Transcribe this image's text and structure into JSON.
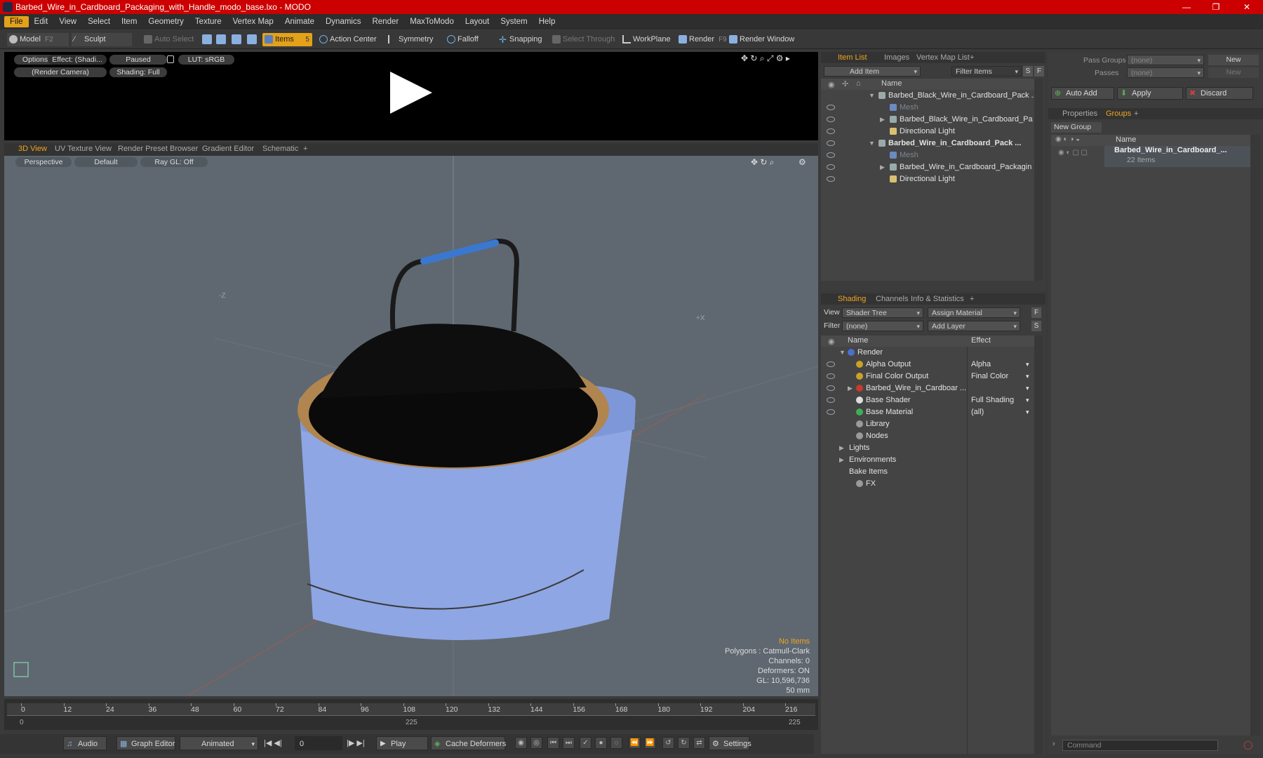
{
  "window": {
    "title": "Barbed_Wire_in_Cardboard_Packaging_with_Handle_modo_base.lxo - MODO",
    "controls": {
      "minimize": "—",
      "maximize": "❐",
      "close": "✕"
    }
  },
  "menu": [
    "File",
    "Edit",
    "View",
    "Select",
    "Item",
    "Geometry",
    "Texture",
    "Vertex Map",
    "Animate",
    "Dynamics",
    "Render",
    "MaxToModo",
    "Layout",
    "System",
    "Help"
  ],
  "toolbar": {
    "model": "Model",
    "model_key": "F2",
    "sculpt": "Sculpt",
    "auto_select": "Auto Select",
    "items": "Items",
    "items_key": "5",
    "action_center": "Action Center",
    "symmetry": "Symmetry",
    "falloff": "Falloff",
    "snapping": "Snapping",
    "select_through": "Select Through",
    "workplane": "WorkPlane",
    "render": "Render",
    "render_key": "F9",
    "render_window": "Render Window"
  },
  "preview": {
    "options": "Options",
    "effect": "Effect: (Shadi...",
    "paused": "Paused",
    "lut": "LUT: sRGB",
    "camera": "(Render Camera)",
    "shading": "Shading: Full"
  },
  "viewport_tabs": [
    "3D View",
    "UV Texture View",
    "Render Preset Browser",
    "Gradient Editor",
    "Schematic",
    "+"
  ],
  "viewport": {
    "perspective": "Perspective",
    "default": "Default",
    "raygl": "Ray GL: Off",
    "axis_neg_z": "-Z",
    "axis_pos_x": "+X",
    "stats": {
      "no_items": "No Items",
      "polygons": "Polygons : Catmull-Clark",
      "channels": "Channels: 0",
      "deformers": "Deformers: ON",
      "gl": "GL: 10,596,736",
      "lens": "50 mm"
    }
  },
  "timeline": {
    "ticks": [
      "0",
      "12",
      "24",
      "36",
      "48",
      "60",
      "72",
      "84",
      "96",
      "108",
      "120",
      "132",
      "144",
      "156",
      "168",
      "180",
      "192",
      "204",
      "216"
    ],
    "start": "0",
    "mid": "225",
    "end": "225"
  },
  "bottombar": {
    "audio": "Audio",
    "graph_editor": "Graph Editor",
    "animated": "Animated",
    "frame": "0",
    "play": "Play",
    "cache": "Cache Deformers",
    "settings": "Settings"
  },
  "itemlist": {
    "tabs": [
      "Item List",
      "Images",
      "Vertex Map List",
      "+"
    ],
    "add_item": "Add Item",
    "filter": "Filter Items",
    "s": "S",
    "f": "F",
    "col_name": "Name",
    "rows": [
      {
        "label": "Barbed_Black_Wire_in_Cardboard_Pack ...",
        "indent": 0,
        "bold": false,
        "eye": false,
        "tri": "▼"
      },
      {
        "label": "Mesh",
        "indent": 1,
        "bold": false,
        "dim": true,
        "eye": true,
        "tri": ""
      },
      {
        "label": "Barbed_Black_Wire_in_Cardboard_Pa ...",
        "indent": 1,
        "bold": false,
        "eye": true,
        "tri": "▶"
      },
      {
        "label": "Directional Light",
        "indent": 1,
        "bold": false,
        "eye": true,
        "tri": ""
      },
      {
        "label": "Barbed_Wire_in_Cardboard_Pack ...",
        "indent": 0,
        "bold": true,
        "eye": true,
        "tri": "▼"
      },
      {
        "label": "Mesh",
        "indent": 1,
        "bold": false,
        "dim": true,
        "eye": true,
        "tri": ""
      },
      {
        "label": "Barbed_Wire_in_Cardboard_Packagin ...",
        "indent": 1,
        "bold": false,
        "eye": true,
        "tri": "▶"
      },
      {
        "label": "Directional Light",
        "indent": 1,
        "bold": false,
        "eye": true,
        "tri": ""
      }
    ]
  },
  "shading": {
    "tabs": [
      "Shading",
      "Channels",
      "Info & Statistics",
      "+"
    ],
    "view_label": "View",
    "view": "Shader Tree",
    "assign": "Assign Material",
    "filter_label": "Filter",
    "filter": "(none)",
    "add_layer": "Add Layer",
    "f": "F",
    "s": "S",
    "col_name": "Name",
    "col_effect": "Effect",
    "rows": [
      {
        "label": "Render",
        "effect": "",
        "indent": 0,
        "tri": "▼",
        "eye": false,
        "color": "#4a6fd0"
      },
      {
        "label": "Alpha Output",
        "effect": "Alpha",
        "indent": 1,
        "tri": "",
        "eye": true,
        "color": "#c9a227"
      },
      {
        "label": "Final Color Output",
        "effect": "Final Color",
        "indent": 1,
        "tri": "",
        "eye": true,
        "color": "#c9a227"
      },
      {
        "label": "Barbed_Wire_in_Cardboar ...",
        "effect": "",
        "indent": 1,
        "tri": "▶",
        "eye": true,
        "color": "#c83a2a"
      },
      {
        "label": "Base Shader",
        "effect": "Full Shading",
        "indent": 1,
        "tri": "",
        "eye": true,
        "color": "#dddddd"
      },
      {
        "label": "Base Material",
        "effect": "(all)",
        "indent": 1,
        "tri": "",
        "eye": true,
        "color": "#3fae55"
      },
      {
        "label": "Library",
        "effect": "",
        "indent": 1,
        "tri": "",
        "eye": false,
        "color": "#9a9a9a"
      },
      {
        "label": "Nodes",
        "effect": "",
        "indent": 1,
        "tri": "",
        "eye": false,
        "color": "#9a9a9a"
      },
      {
        "label": "Lights",
        "effect": "",
        "indent": 0,
        "tri": "▶",
        "eye": false,
        "color": ""
      },
      {
        "label": "Environments",
        "effect": "",
        "indent": 0,
        "tri": "▶",
        "eye": false,
        "color": ""
      },
      {
        "label": "Bake Items",
        "effect": "",
        "indent": 0,
        "tri": "",
        "eye": false,
        "color": ""
      },
      {
        "label": "FX",
        "effect": "",
        "indent": 1,
        "tri": "",
        "eye": false,
        "color": "#9a9a9a"
      }
    ]
  },
  "groups": {
    "pass_groups_label": "Pass Groups",
    "pass_groups": "(none)",
    "passes_label": "Passes",
    "passes": "(none)",
    "new1": "New",
    "new2": "New",
    "auto_add": "Auto Add",
    "apply": "Apply",
    "discard": "Discard",
    "tabs": [
      "Properties",
      "Groups",
      "+"
    ],
    "new_group": "New Group",
    "col_name": "Name",
    "group_name": "Barbed_Wire_in_Cardboard_...",
    "group_count": "22 Items"
  },
  "command": {
    "placeholder": "Command"
  },
  "colors": {
    "accent": "#f0a41e",
    "titlebar": "#cc0000",
    "viewport": "#5f6870",
    "cardboard": "#8ea6e3"
  }
}
